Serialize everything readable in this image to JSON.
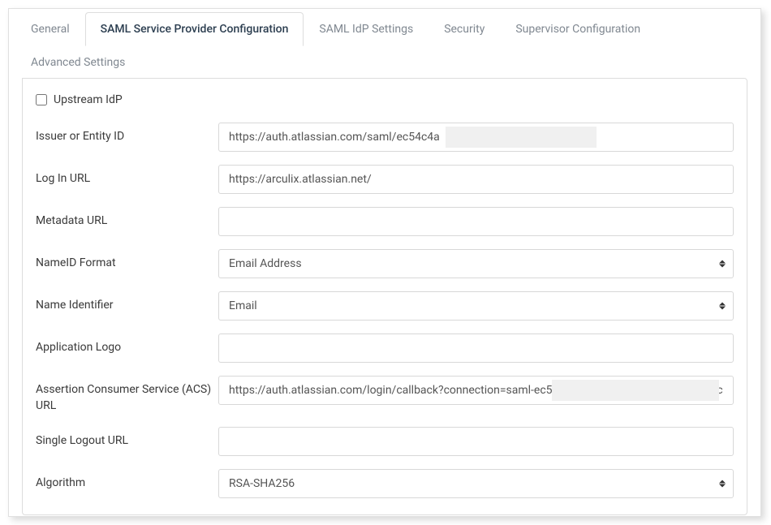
{
  "tabs": [
    {
      "label": "General"
    },
    {
      "label": "SAML Service Provider Configuration"
    },
    {
      "label": "SAML IdP Settings"
    },
    {
      "label": "Security"
    },
    {
      "label": "Supervisor Configuration"
    },
    {
      "label": "Advanced Settings"
    }
  ],
  "form": {
    "upstream_idp_label": "Upstream IdP",
    "issuer_label": "Issuer or Entity ID",
    "issuer_value": "https://auth.atlassian.com/saml/ec54c4a                                                   f",
    "login_url_label": "Log In URL",
    "login_url_value": "https://arculix.atlassian.net/",
    "metadata_url_label": "Metadata URL",
    "metadata_url_value": "",
    "nameid_format_label": "NameID Format",
    "nameid_format_value": "Email Address",
    "name_identifier_label": "Name Identifier",
    "name_identifier_value": "Email",
    "application_logo_label": "Application Logo",
    "application_logo_value": "",
    "acs_url_label": "Assertion Consumer Service (ACS) URL",
    "acs_url_value": "https://auth.atlassian.com/login/callback?connection=saml-ec54c                                                      cff",
    "single_logout_label": "Single Logout URL",
    "single_logout_value": "",
    "algorithm_label": "Algorithm",
    "algorithm_value": "RSA-SHA256"
  }
}
